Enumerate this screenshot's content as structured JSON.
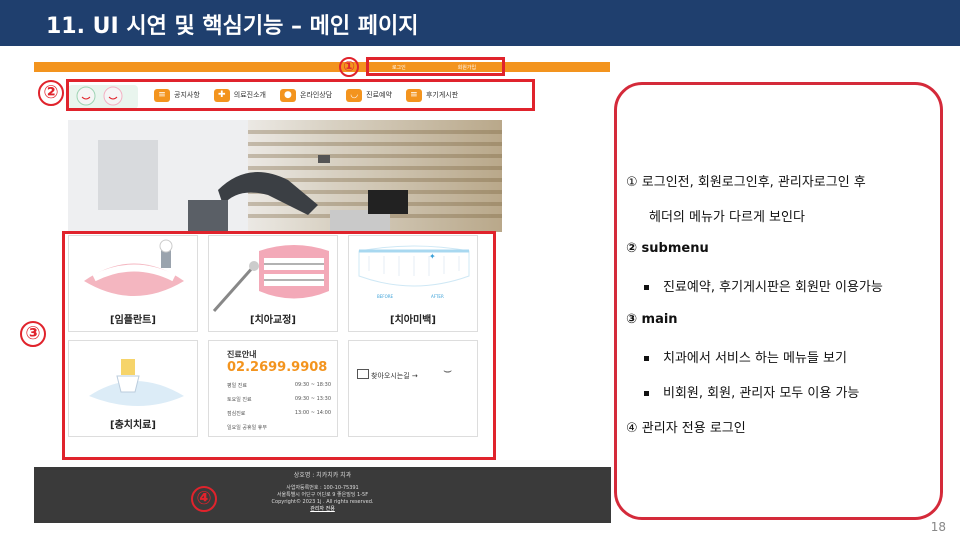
{
  "slide_title": "11. UI 시연 및 핵심기능 – 메인 페이지",
  "markers": [
    "①",
    "②",
    "③",
    "④"
  ],
  "header_links": [
    "로그인",
    "회원가입"
  ],
  "nav_items": [
    {
      "label": "공지사항",
      "icon": "megaphone-icon"
    },
    {
      "label": "의료진소개",
      "icon": "plus-cross-icon"
    },
    {
      "label": "온라인상담",
      "icon": "person-icon"
    },
    {
      "label": "진료예약",
      "icon": "tooth-icon"
    },
    {
      "label": "후기게시판",
      "icon": "notepad-icon"
    }
  ],
  "tiles": [
    {
      "label": "[임플란트]"
    },
    {
      "label": "[치아교정]"
    },
    {
      "label": "[치아미백]"
    },
    {
      "label": "[충치치료]"
    }
  ],
  "whitening_labels": [
    "BEFORE",
    "AFTER"
  ],
  "info": {
    "title": "진료안내",
    "phone": "02.2699.9908",
    "rows": [
      {
        "label": "평일 진료",
        "time": "09:30 ~ 18:30"
      },
      {
        "label": "토요일 진료",
        "time": "09:30 ~ 13:30"
      },
      {
        "label": "점심진료",
        "time": "13:00 ~ 14:00"
      },
      {
        "label": "일요일 공휴일 휴무",
        "time": ""
      }
    ]
  },
  "directions": "찾아오시는길 →",
  "footer": {
    "name": "상호명 : 치카치카 치과",
    "reg": "사업자등록번호 : 100-10-75391",
    "address": "서울특별시 어딘구 어딘로 9 좋은빌딩 1-5F",
    "copyright": "Copyright© 2023 1j . All rights reserved.",
    "admin_link": "관리자 전용"
  },
  "notes": {
    "item1_line1": "①  로그인전, 회원로그인후, 관리자로그인 후",
    "item1_line2": "헤더의 메뉴가 다르게 보인다",
    "item2": "②  submenu",
    "item2_sub": "진료예약, 후기게시판은 회원만 이용가능",
    "item3": "③  main",
    "item3_sub1": "치과에서 서비스 하는 메뉴들 보기",
    "item3_sub2": "비회원, 회원, 관리자 모두 이용 가능",
    "item4": "④  관리자 전용 로그인"
  },
  "page_number": "18",
  "colors": {
    "title_bar": "#1f3f6e",
    "accent_orange": "#f3941e",
    "marker_red": "#e0232c",
    "footer_bg": "#3a3a3a"
  }
}
